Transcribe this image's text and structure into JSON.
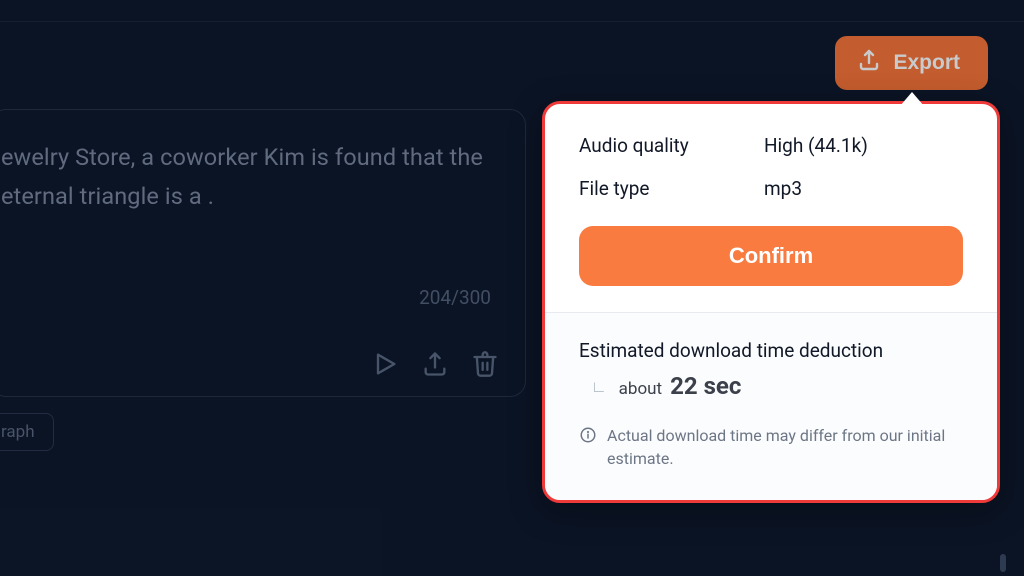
{
  "colors": {
    "accent": "#f97335",
    "highlight_border": "#ef3a3a",
    "bg": "#0e1729"
  },
  "header": {
    "export_label": "Export"
  },
  "editor": {
    "body_text": "ewelry Store, a coworker Kim is found that the eternal triangle is a .",
    "char_count": "204/300"
  },
  "paragraph_pill": {
    "label": "raph"
  },
  "popover": {
    "audio_quality_label": "Audio quality",
    "audio_quality_value": "High (44.1k)",
    "file_type_label": "File type",
    "file_type_value": "mp3",
    "confirm_label": "Confirm",
    "estimate_title": "Estimated download time deduction",
    "estimate_about": "about",
    "estimate_value": "22 sec",
    "note": "Actual download time may differ from our initial estimate."
  }
}
